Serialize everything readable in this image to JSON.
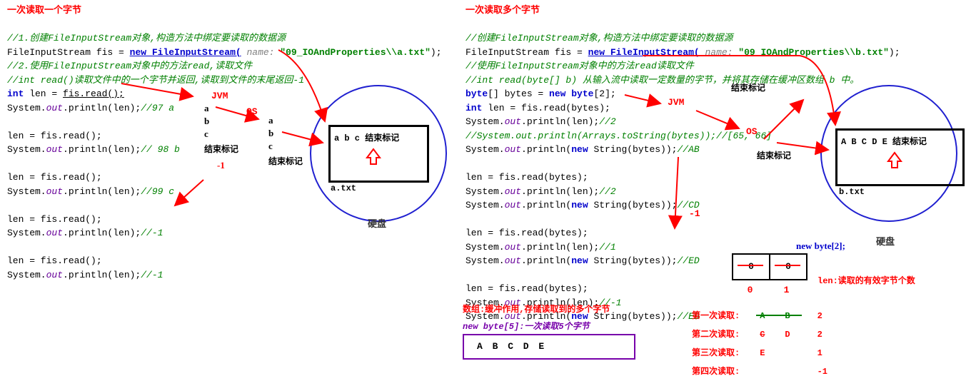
{
  "left": {
    "title": "一次读取一个字节",
    "c1": "//1.创建FileInputStream对象,构造方法中绑定要读取的数据源",
    "l1a": "FileInputStream fis = ",
    "l1b": "new FileInputStream(",
    "l1n": " name:",
    "l1s": " \"09_IOAndProperties\\\\a.txt\"",
    "l1e": ");",
    "c2": "//2.使用FileInputStream对象中的方法read,读取文件",
    "c3": "//int read()读取文件中的一个字节并返回,读取到文件的末尾返回-1",
    "l2a": "int",
    "l2b": " len = ",
    "l2c": "fis.read();",
    "l3a": "System.",
    "l3b": "out",
    "l3c": ".println(len);",
    "cm97": "//97 a",
    "r1": "len = fis.read();",
    "cm98": "// 98 b",
    "cm99": "//99 c",
    "cmN1": "//-1",
    "jvm": "JVM",
    "os": "OS",
    "col_a": "a",
    "col_b": "b",
    "col_c": "c",
    "endmark": "结束标记",
    "neg1": "-1",
    "file_content": "a b c 结束标记",
    "file_name": "a.txt",
    "disk": "硬盘"
  },
  "right": {
    "title": "一次读取多个字节",
    "c1": "//创建FileInputStream对象,构造方法中绑定要读取的数据源",
    "l1a": "FileInputStream fis = ",
    "l1b": "new FileInputStream(",
    "l1n": " name:",
    "l1s": " \"09_IOAndProperties\\\\b.txt\"",
    "l1e": ");",
    "c2": "//使用FileInputStream对象中的方法read读取文件",
    "c3": "//int read(byte[] b) 从输入流中读取一定数量的字节，并将其存储在缓冲区数组 b 中。",
    "l2a": "byte",
    "l2b": "[] bytes = ",
    "l2c": "new byte",
    "l2d": "[2];",
    "l3a": "int",
    "l3b": " len = fis.read(bytes);",
    "lpa": "System.",
    "lpb": "out",
    "lpc": ".println(len);",
    "cm2": "//2",
    "cArr": "//System.out.println(Arrays.toString(bytes));//[65, 66]",
    "lstr": ".println(",
    "lnew": "new",
    "lstrb": " String(bytes));",
    "cAB": "//AB",
    "rb": "len = fis.read(bytes);",
    "cCD": "//CD",
    "cm1": "//1",
    "cED": "//ED",
    "cmN1": "//-1",
    "jvm": "JVM",
    "os": "OS",
    "endmark": "结束标记",
    "neg1": "-1",
    "file_content": "A B C D E 结束标记",
    "file_name": "b.txt",
    "disk": "硬盘",
    "arr_note1": "数组:缓冲作用,存储读取到的多个字节",
    "arr_note2": "new byte[5]:一次读取5个字节",
    "box5": "A B C D E",
    "nb2": "new byte[2];",
    "idx0": "0",
    "idx1": "1",
    "zero1": "0",
    "zero2": "0",
    "len_note": "len:读取的有效字节个数",
    "t_r1": "第一次读取:",
    "t_r2": "第二次读取:",
    "t_r3": "第三次读取:",
    "t_r4": "第四次读取:",
    "t_A": "A",
    "t_B": "B",
    "t_C": "C",
    "t_D": "D",
    "t_E": "E",
    "t_v2a": "2",
    "t_v2b": "2",
    "t_v1": "1",
    "t_vN1": "-1"
  }
}
